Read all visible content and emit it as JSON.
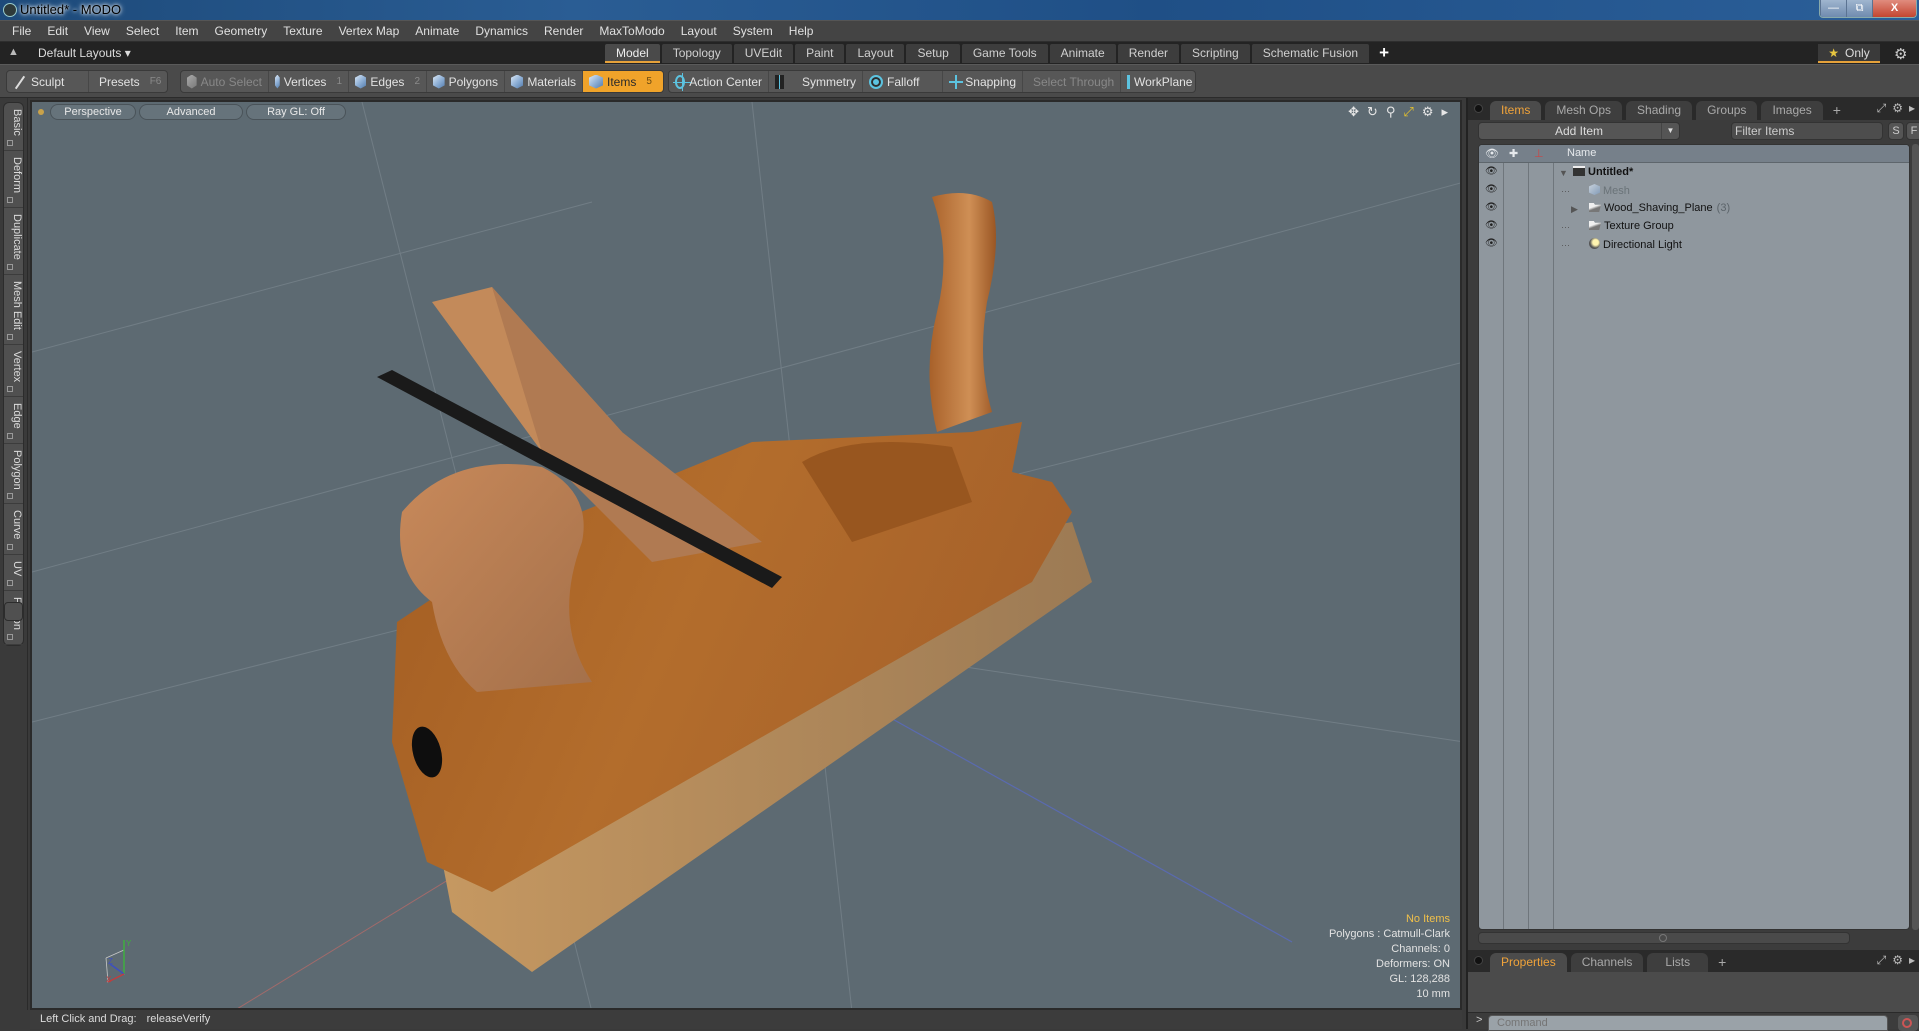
{
  "window": {
    "title": "Untitled* - MODO",
    "controls": [
      "minimize",
      "restore",
      "close"
    ]
  },
  "menu": [
    "File",
    "Edit",
    "View",
    "Select",
    "Item",
    "Geometry",
    "Texture",
    "Vertex Map",
    "Animate",
    "Dynamics",
    "Render",
    "MaxToModo",
    "Layout",
    "System",
    "Help"
  ],
  "layout_bar": {
    "layouts_label": "Default Layouts ▾",
    "tabs": [
      "Model",
      "Topology",
      "UVEdit",
      "Paint",
      "Layout",
      "Setup",
      "Game Tools",
      "Animate",
      "Render",
      "Scripting",
      "Schematic Fusion"
    ],
    "active_tab": "Model",
    "add_label": "+",
    "only_label": "Only"
  },
  "toolbar": {
    "sculpt": "Sculpt",
    "presets": "Presets",
    "presets_key": "F6",
    "auto_select": "Auto Select",
    "vertices": "Vertices",
    "vertices_key": "1",
    "edges": "Edges",
    "edges_key": "2",
    "polygons": "Polygons",
    "materials": "Materials",
    "items": "Items",
    "items_key": "5",
    "action_center": "Action Center",
    "symmetry": "Symmetry",
    "falloff": "Falloff",
    "snapping": "Snapping",
    "select_through": "Select Through",
    "workplane": "WorkPlane",
    "active_mode": "Items",
    "accent_color": "#f0a32a"
  },
  "left_tabs": [
    "Basic",
    "Deform",
    "Duplicate",
    "Mesh Edit",
    "Vertex",
    "Edge",
    "Polygon",
    "Curve",
    "UV",
    "Fusion"
  ],
  "viewport": {
    "view_mode": "Perspective",
    "shading": "Advanced",
    "raygl": "Ray GL: Off",
    "nav_icons": [
      "move-icon",
      "rotate-icon",
      "zoom-icon",
      "maximize-icon",
      "gear-icon",
      "arrow-right-icon"
    ],
    "info": {
      "selection": "No Items",
      "polygons": "Polygons : Catmull-Clark",
      "channels": "Channels: 0",
      "deformers": "Deformers: ON",
      "gl": "GL: 128,288",
      "grid": "10 mm"
    },
    "axis_labels": [
      "X",
      "Y",
      "Z"
    ]
  },
  "status_bar": {
    "label": "Left Click and Drag:",
    "value": "releaseVerify"
  },
  "items_panel": {
    "tabs": [
      "Items",
      "Mesh Ops",
      "Shading",
      "Groups",
      "Images"
    ],
    "active_tab": "Items",
    "add_item": "Add Item",
    "filter_placeholder": "Filter Items",
    "s_button": "S",
    "f_button": "F",
    "column_name": "Name",
    "rows": [
      {
        "label": "Untitled*",
        "type": "scene",
        "count": ""
      },
      {
        "label": "Mesh",
        "type": "mesh",
        "count": ""
      },
      {
        "label": "Wood_Shaving_Plane",
        "type": "group",
        "count": "(3)"
      },
      {
        "label": "Texture Group",
        "type": "group",
        "count": ""
      },
      {
        "label": "Directional Light",
        "type": "light",
        "count": ""
      }
    ]
  },
  "properties_panel": {
    "tabs": [
      "Properties",
      "Channels",
      "Lists"
    ],
    "active_tab": "Properties"
  },
  "command": {
    "prompt": ">",
    "placeholder": "Command"
  }
}
